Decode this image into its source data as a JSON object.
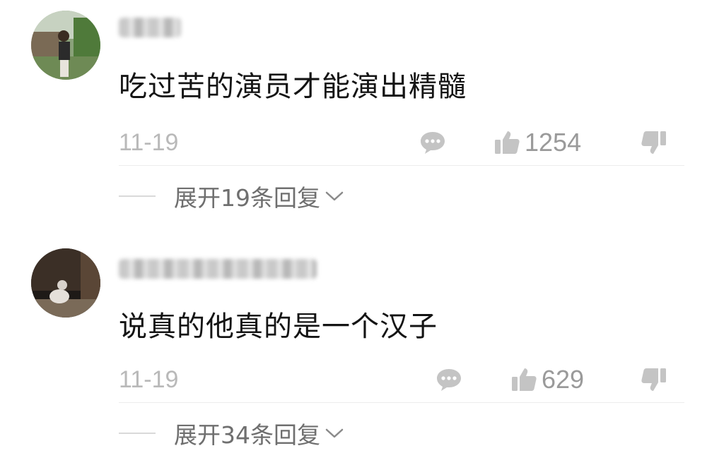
{
  "comments": [
    {
      "username": "",
      "text": "吃过苦的演员才能演出精髓",
      "date": "11-19",
      "likes": "1254",
      "expand_label": "展开19条回复",
      "icons": {
        "reply": "chat-bubble-icon",
        "like": "thumbs-up-icon",
        "dislike": "thumbs-down-icon",
        "expand": "chevron-down-icon"
      }
    },
    {
      "username": "",
      "text": "说真的他真的是一个汉子",
      "date": "11-19",
      "likes": "629",
      "expand_label": "展开34条回复",
      "icons": {
        "reply": "chat-bubble-icon",
        "like": "thumbs-up-icon",
        "dislike": "thumbs-down-icon",
        "expand": "chevron-down-icon"
      }
    }
  ],
  "colors": {
    "text": "#141414",
    "muted": "#b9b9b9",
    "icon": "#c4c4c4",
    "expand_text": "#6f6f6f"
  }
}
